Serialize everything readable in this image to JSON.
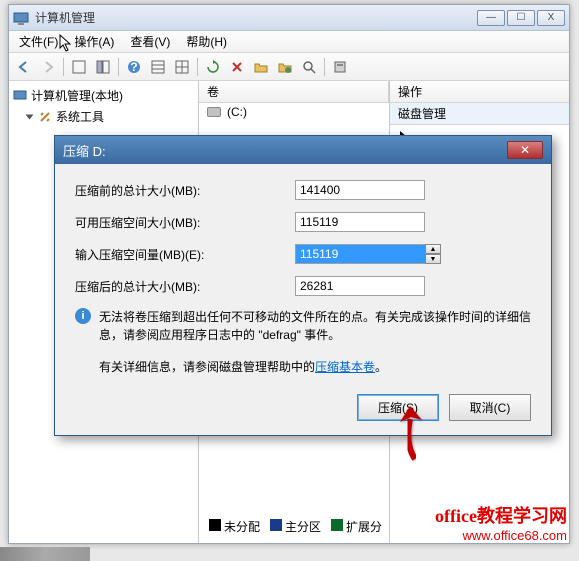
{
  "window": {
    "title": "计算机管理",
    "min": "—",
    "max": "☐",
    "close": "X"
  },
  "menu": {
    "file": "文件(F)",
    "action": "操作(A)",
    "view": "查看(V)",
    "help": "帮助(H)"
  },
  "tree": {
    "root": "计算机管理(本地)",
    "systools": "系统工具"
  },
  "volumes": {
    "header": "卷",
    "c": "(C:)"
  },
  "actions": {
    "header": "操作",
    "disk_mgmt": "磁盘管理"
  },
  "legend": {
    "unalloc": "未分配",
    "primary": "主分区",
    "ext": "扩展分"
  },
  "dialog": {
    "title": "压缩 D:",
    "row1": "压缩前的总计大小(MB):",
    "val1": "141400",
    "row2": "可用压缩空间大小(MB):",
    "val2": "115119",
    "row3": "输入压缩空间量(MB)(E):",
    "val3": "115119",
    "row4": "压缩后的总计大小(MB):",
    "val4": "26281",
    "info": "无法将卷压缩到超出任何不可移动的文件所在的点。有关完成该操作时间的详细信息，请参阅应用程序日志中的 \"defrag\" 事件。",
    "link_prefix": "有关详细信息，请参阅磁盘管理帮助中的",
    "link_text": "压缩基本卷",
    "link_suffix": "。",
    "btn_shrink": "压缩(S)",
    "btn_cancel": "取消(C)"
  },
  "watermark": {
    "line1": "office教程学习网",
    "line2": "www.office68.com"
  }
}
